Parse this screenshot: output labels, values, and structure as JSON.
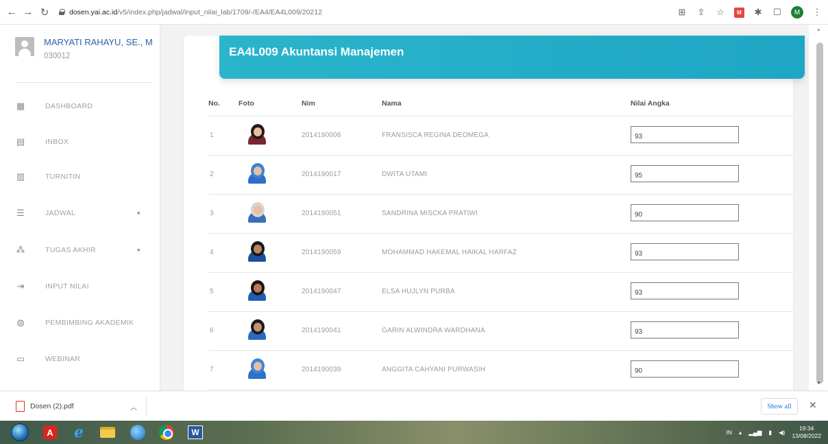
{
  "browser": {
    "url_host": "dosen.yai.ac.id",
    "url_path": "/v5/index.php/jadwal/input_nilai_lab/1709/-/EA4/EA4L009/20212",
    "profile_initial": "M"
  },
  "sidebar": {
    "user_name": "MARYATI RAHAYU, SE., M",
    "user_id": "030012",
    "items": [
      {
        "label": "DASHBOARD",
        "icon": "dashboard-icon",
        "caret": false
      },
      {
        "label": "INBOX",
        "icon": "inbox-icon",
        "caret": false
      },
      {
        "label": "TURNITIN",
        "icon": "turnitin-icon",
        "caret": false
      },
      {
        "label": "JADWAL",
        "icon": "schedule-icon",
        "caret": true
      },
      {
        "label": "TUGAS AKHIR",
        "icon": "users-icon",
        "caret": true
      },
      {
        "label": "INPUT NILAI",
        "icon": "input-icon",
        "caret": false
      },
      {
        "label": "PEMBIMBING AKADEMIK",
        "icon": "advisor-icon",
        "caret": false
      },
      {
        "label": "WEBINAR",
        "icon": "webinar-icon",
        "caret": false
      }
    ]
  },
  "card": {
    "title": "EA4L009 Akuntansi Manajemen"
  },
  "table": {
    "headers": {
      "no": "No.",
      "foto": "Foto",
      "nim": "Nim",
      "nama": "Nama",
      "nilai": "Nilai Angka"
    },
    "rows": [
      {
        "no": "1",
        "nim": "2014190006",
        "nama": "FRANSISCA REGINA DEOMEGA",
        "nilai": "93"
      },
      {
        "no": "2",
        "nim": "2014190017",
        "nama": "DWITA UTAMI",
        "nilai": "95"
      },
      {
        "no": "3",
        "nim": "2014190051",
        "nama": "SANDRINA MISCKA PRATIWI",
        "nilai": "90"
      },
      {
        "no": "4",
        "nim": "2014190059",
        "nama": "MOHAMMAD HAKEMAL HAIKAL HARFAZ",
        "nilai": "93"
      },
      {
        "no": "5",
        "nim": "2014190047",
        "nama": "ELSA HUJLYN PURBA",
        "nilai": "93"
      },
      {
        "no": "6",
        "nim": "2014190041",
        "nama": "GARIN ALWINDRA WARDHANA",
        "nilai": "93"
      },
      {
        "no": "7",
        "nim": "2014190039",
        "nama": "ANGGITA CAHYANI PURWASIH",
        "nilai": "90"
      }
    ]
  },
  "downloads": {
    "file_name": "Dosen (2).pdf",
    "show_all": "Show all"
  },
  "taskbar": {
    "lang": "IN",
    "time": "19:34",
    "date": "13/08/2022"
  },
  "colors": {
    "header_accent": "#2ab5cc",
    "user_name": "#2a62a8"
  }
}
